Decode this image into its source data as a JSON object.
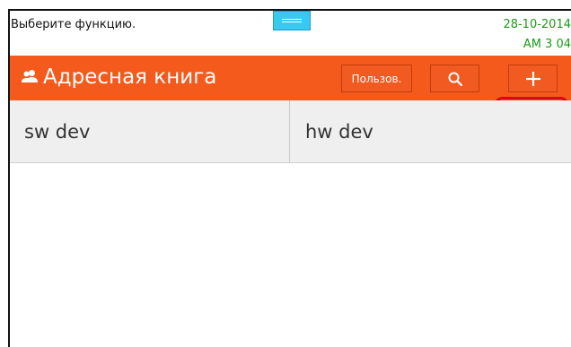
{
  "status": {
    "message": "Выберите функцию.",
    "date": "28-10-2014",
    "time": "AM 3 04"
  },
  "header": {
    "title": "Адресная книга",
    "users_button": "Пользов.",
    "icons": {
      "title": "address-book-icon",
      "search": "search-icon",
      "add": "plus-icon"
    }
  },
  "tabs": [
    {
      "label": "sw dev"
    },
    {
      "label": "hw dev"
    }
  ],
  "colors": {
    "title_bar": "#f35a1c",
    "handle": "#39c8ef",
    "datetime": "#1a9a1a",
    "highlight": "#e2001a"
  }
}
